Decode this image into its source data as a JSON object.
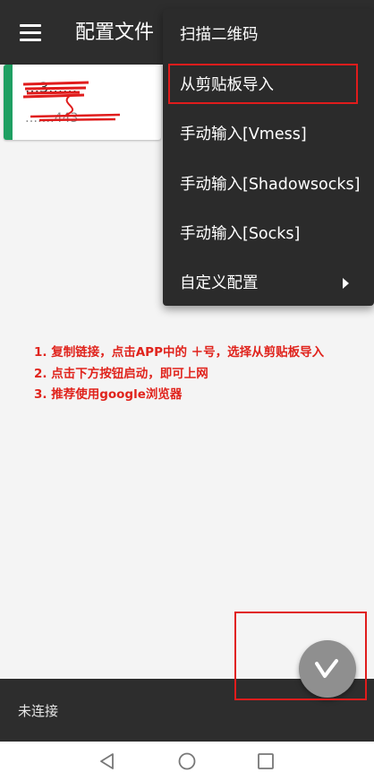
{
  "app_bar": {
    "title": "配置文件"
  },
  "profile_card": {
    "name": "…3……",
    "address": "……:443",
    "accent_color": "#1f9f62"
  },
  "overflow_menu": {
    "items": [
      {
        "label": "扫描二维码"
      },
      {
        "label": "从剪贴板导入",
        "highlighted": true
      },
      {
        "label": "手动输入[Vmess]"
      },
      {
        "label": "手动输入[Shadowsocks]"
      },
      {
        "label": "手动输入[Socks]"
      },
      {
        "label": "自定义配置",
        "has_submenu": true
      }
    ]
  },
  "instructions": [
    "1. 复制链接，点击APP中的 ＋号，选择从剪贴板导入",
    "2. 点击下方按钮启动，即可上网",
    "3. 推荐使用google浏览器"
  ],
  "status_bar": {
    "status": "未连接"
  },
  "fab": {
    "icon": "v-logo-icon"
  },
  "nav_bar": {
    "icons": [
      "back-icon",
      "home-icon",
      "recent-apps-icon"
    ]
  },
  "colors": {
    "app_bar": "#2d2d2d",
    "menu": "#2b2b2b",
    "annotation_red": "#e01c1c",
    "fab": "#8f8f8f"
  }
}
